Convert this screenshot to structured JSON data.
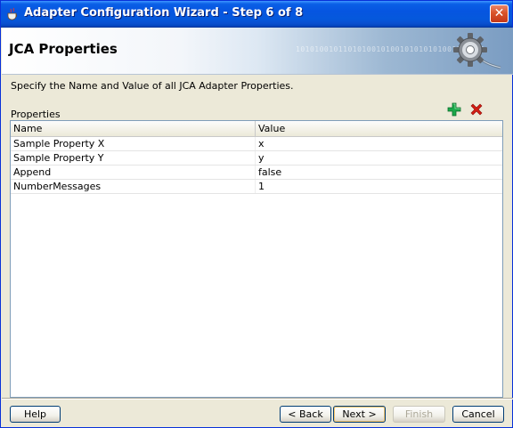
{
  "window": {
    "title": "Adapter Configuration Wizard - Step 6 of 8",
    "close_glyph": "✕"
  },
  "header": {
    "title": "JCA Properties",
    "binary_decor": "1010100101101010010100101010101001101001"
  },
  "instructions": "Specify the Name and Value of all JCA Adapter Properties.",
  "properties": {
    "label": "Properties",
    "columns": [
      "Name",
      "Value"
    ],
    "rows": [
      {
        "name": "Sample Property X",
        "value": "x"
      },
      {
        "name": "Sample Property Y",
        "value": "y"
      },
      {
        "name": "Append",
        "value": "false"
      },
      {
        "name": "NumberMessages",
        "value": "1"
      }
    ]
  },
  "buttons": {
    "help": "Help",
    "back": "< Back",
    "next": "Next >",
    "finish": "Finish",
    "cancel": "Cancel"
  },
  "icons": {
    "add": "add-icon",
    "delete": "delete-icon",
    "gear": "gear-icon"
  },
  "colors": {
    "titlebar": "#0655e0",
    "dialog_bg": "#ece9d8",
    "add_icon": "#1aa84a",
    "delete_icon": "#d41e14"
  }
}
